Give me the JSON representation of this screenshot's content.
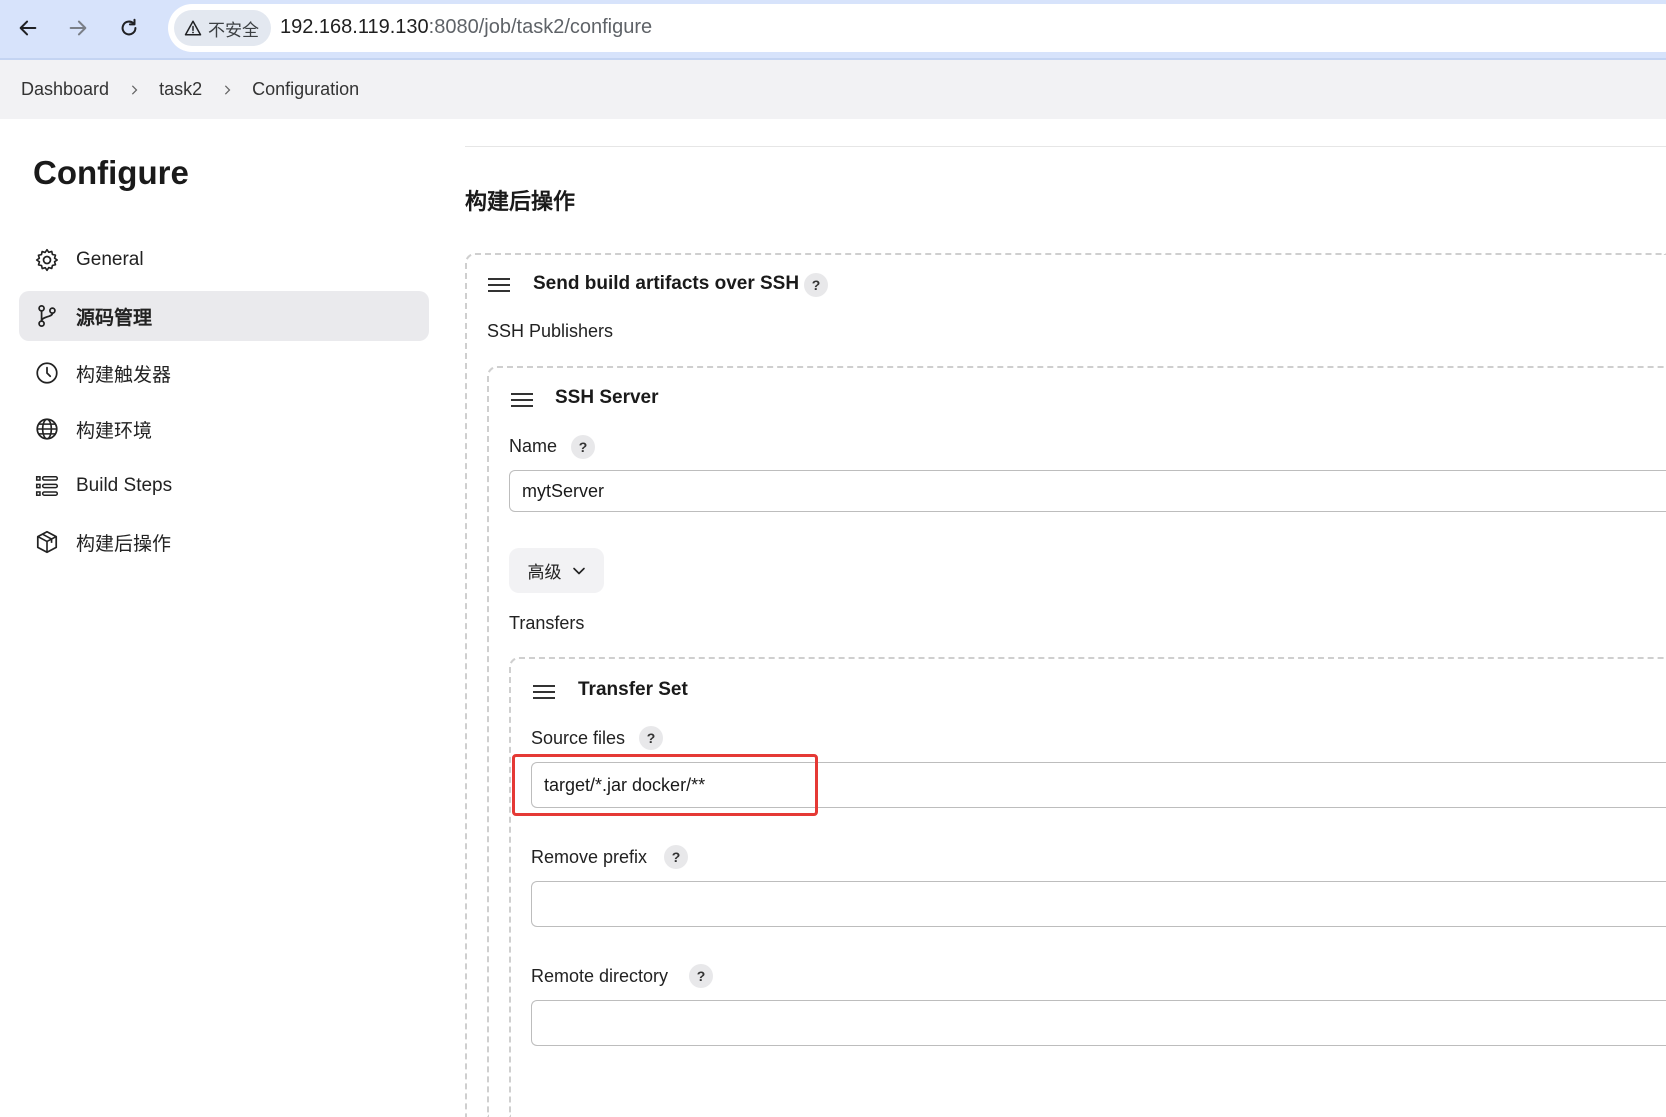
{
  "browser": {
    "security_label": "不安全",
    "url_host": "192.168.119.130",
    "url_path": ":8080/job/task2/configure"
  },
  "breadcrumb": [
    "Dashboard",
    "task2",
    "Configuration"
  ],
  "sidebar": {
    "title": "Configure",
    "items": [
      {
        "label": "General",
        "icon": "gear-icon"
      },
      {
        "label": "源码管理",
        "icon": "branch-icon",
        "active": true
      },
      {
        "label": "构建触发器",
        "icon": "clock-icon"
      },
      {
        "label": "构建环境",
        "icon": "globe-icon"
      },
      {
        "label": "Build Steps",
        "icon": "list-icon"
      },
      {
        "label": "构建后操作",
        "icon": "package-icon"
      }
    ]
  },
  "main": {
    "section_title": "构建后操作",
    "publisher": {
      "title": "Send build artifacts over SSH",
      "help": "?",
      "publishers_label": "SSH Publishers",
      "server": {
        "title": "SSH Server",
        "name_label": "Name",
        "name_help": "?",
        "name_value": "mytServer",
        "advanced_label": "高级",
        "transfers_label": "Transfers",
        "transfer_set": {
          "title": "Transfer Set",
          "source_label": "Source files",
          "source_help": "?",
          "source_value": "target/*.jar docker/**",
          "remove_prefix_label": "Remove prefix",
          "remove_prefix_help": "?",
          "remove_prefix_value": "",
          "remote_dir_label": "Remote directory",
          "remote_dir_help": "?",
          "remote_dir_value": ""
        }
      }
    }
  },
  "colors": {
    "browser_bar": "#d7e3fb",
    "highlight": "#e53935",
    "active_item": "#eaeaed"
  }
}
